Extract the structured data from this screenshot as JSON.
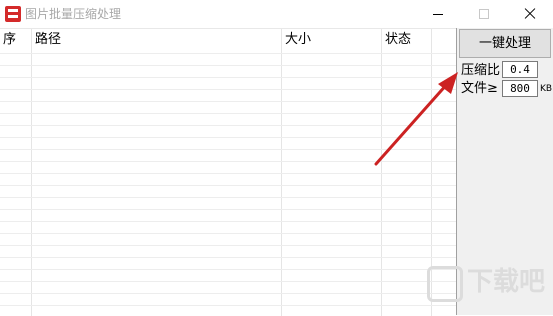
{
  "window": {
    "title": "图片批量压缩处理"
  },
  "table": {
    "headers": [
      "序",
      "路径",
      "大小",
      "状态"
    ]
  },
  "panel": {
    "process_button": "一键处理",
    "ratio_label": "压缩比",
    "ratio_value": "0.4",
    "file_label": "文件≥",
    "file_value": "800",
    "file_unit": "KB"
  },
  "watermark": {
    "text": "下载吧"
  },
  "colors": {
    "arrow": "#cc2222",
    "app_icon": "#d42a2a"
  }
}
